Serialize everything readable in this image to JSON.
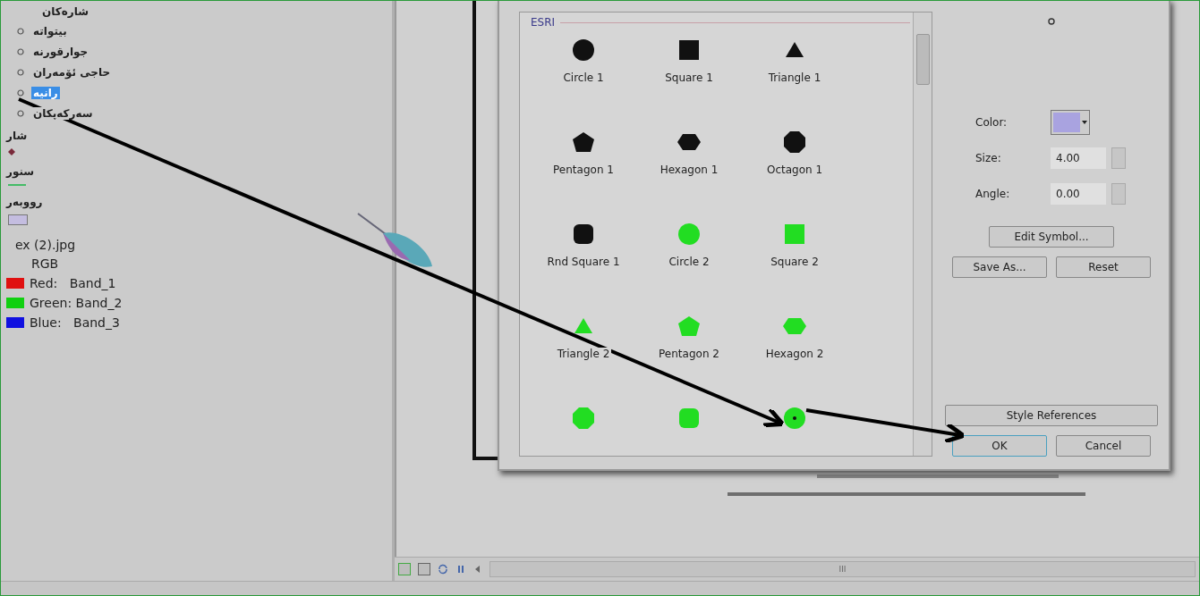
{
  "toc": {
    "groups": [
      {
        "kind": "point-group",
        "title": "شارەکان",
        "items": [
          {
            "label": "بیتواتە",
            "selected": false
          },
          {
            "label": "جوارقورنە",
            "selected": false
          },
          {
            "label": "حاجی ئۆمەران",
            "selected": false
          },
          {
            "label": "رانیە",
            "selected": true
          },
          {
            "label": "سەرکەپکان",
            "selected": false
          }
        ]
      },
      {
        "kind": "diamond",
        "title": "شار",
        "color": "#7a2a3a"
      },
      {
        "kind": "line",
        "title": "سنور",
        "color": "#44bb66"
      },
      {
        "kind": "fill",
        "title": "رووبەر",
        "color": "#c4bde0"
      },
      {
        "kind": "raster",
        "title": "ex (2).jpg",
        "subtitle": "RGB",
        "bands": [
          {
            "label": "Red:   Band_1",
            "color": "#e01010"
          },
          {
            "label": "Green: Band_2",
            "color": "#10d010"
          },
          {
            "label": "Blue:   Band_3",
            "color": "#1010e0"
          }
        ]
      }
    ]
  },
  "symbol_selector": {
    "style_header": "ESRI",
    "symbols": [
      {
        "kind": "circle",
        "color": "#111111",
        "label": "Circle 1"
      },
      {
        "kind": "square",
        "color": "#111111",
        "label": "Square 1"
      },
      {
        "kind": "triangle",
        "color": "#111111",
        "label": "Triangle 1"
      },
      {
        "kind": "pentagon",
        "color": "#111111",
        "label": "Pentagon 1"
      },
      {
        "kind": "hexagon",
        "color": "#111111",
        "label": "Hexagon 1"
      },
      {
        "kind": "octagon",
        "color": "#111111",
        "label": "Octagon 1"
      },
      {
        "kind": "rndsquare",
        "color": "#111111",
        "label": "Rnd Square 1"
      },
      {
        "kind": "circle",
        "color": "#22dd22",
        "label": "Circle 2"
      },
      {
        "kind": "square",
        "color": "#22dd22",
        "label": "Square 2"
      },
      {
        "kind": "triangle",
        "color": "#22dd22",
        "label": "Triangle 2"
      },
      {
        "kind": "pentagon",
        "color": "#22dd22",
        "label": "Pentagon 2"
      },
      {
        "kind": "hexagon",
        "color": "#22dd22",
        "label": "Hexagon 2"
      },
      {
        "kind": "octagon",
        "color": "#22dd22"
      },
      {
        "kind": "rndsquare",
        "color": "#22dd22"
      },
      {
        "kind": "circledot",
        "color": "#22dd22"
      }
    ],
    "current": {
      "color_label": "Color:",
      "color": "#a9a3e0",
      "size_label": "Size:",
      "size": "4.00",
      "angle_label": "Angle:",
      "angle": "0.00"
    },
    "buttons": {
      "edit": "Edit Symbol...",
      "save_as": "Save As...",
      "reset": "Reset",
      "style_references": "Style References",
      "ok": "OK",
      "cancel": "Cancel"
    }
  },
  "scrollbar_grip": "III"
}
